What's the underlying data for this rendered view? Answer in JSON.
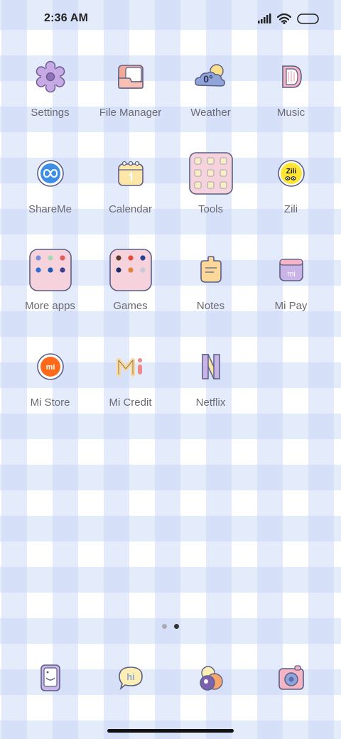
{
  "status_bar": {
    "time": "2:36 AM",
    "icons": [
      "signal-icon",
      "wifi-icon",
      "battery-icon"
    ]
  },
  "apps": [
    {
      "label": "Settings",
      "icon": "gear-icon"
    },
    {
      "label": "File Manager",
      "icon": "folder-icon"
    },
    {
      "label": "Weather",
      "icon": "weather-icon",
      "icon_text": "0°"
    },
    {
      "label": "Music",
      "icon": "music-icon"
    },
    {
      "label": "ShareMe",
      "icon": "shareme-icon"
    },
    {
      "label": "Calendar",
      "icon": "calendar-icon"
    },
    {
      "label": "Tools",
      "icon": "tools-folder-icon"
    },
    {
      "label": "Zili",
      "icon": "zili-icon",
      "icon_text": "Zili"
    },
    {
      "label": "More apps",
      "icon": "more-apps-folder-icon"
    },
    {
      "label": "Games",
      "icon": "games-folder-icon"
    },
    {
      "label": "Notes",
      "icon": "notes-icon"
    },
    {
      "label": "Mi Pay",
      "icon": "mi-pay-icon",
      "icon_text": "mi"
    },
    {
      "label": "Mi Store",
      "icon": "mi-store-icon",
      "icon_text": "mi"
    },
    {
      "label": "Mi Credit",
      "icon": "mi-credit-icon"
    },
    {
      "label": "Netflix",
      "icon": "netflix-icon"
    }
  ],
  "pages": {
    "count": 2,
    "active": 2
  },
  "dock": [
    {
      "icon": "phone-icon"
    },
    {
      "icon": "messages-icon",
      "icon_text": "hi"
    },
    {
      "icon": "browser-icon"
    },
    {
      "icon": "camera-icon"
    }
  ],
  "colors": {
    "label": "#6a6a72",
    "check_pattern": "#c4d2f6",
    "folder_pink": "#f6d2dc",
    "outline": "#5b5f86"
  }
}
